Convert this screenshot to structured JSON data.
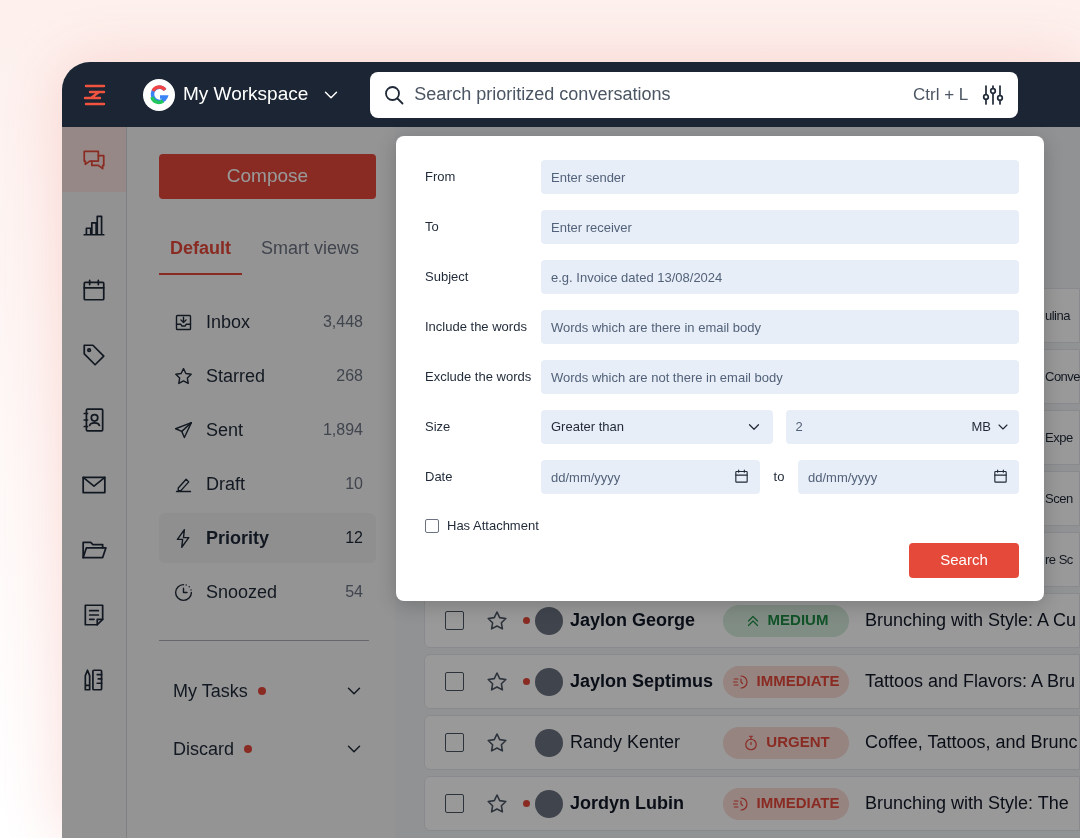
{
  "app_bar": {
    "workspace": "My Workspace",
    "search": {
      "placeholder": "Search prioritized conversations",
      "shortcut": "Ctrl + L"
    }
  },
  "icon_rail": [
    {
      "kind": "chat",
      "selected": true
    },
    {
      "kind": "chart",
      "selected": false
    },
    {
      "kind": "calendar",
      "selected": false
    },
    {
      "kind": "tag",
      "selected": false
    },
    {
      "kind": "contacts",
      "selected": false
    },
    {
      "kind": "mail",
      "selected": false
    },
    {
      "kind": "folder",
      "selected": false
    },
    {
      "kind": "note",
      "selected": false
    },
    {
      "kind": "tools",
      "selected": false
    }
  ],
  "compose": "Compose",
  "tabs": [
    {
      "label": "Default",
      "selected": true
    },
    {
      "label": "Smart views",
      "selected": false
    }
  ],
  "folders": [
    {
      "kind": "inbox",
      "label": "Inbox",
      "count": "3,448",
      "selected": false
    },
    {
      "kind": "star",
      "label": "Starred",
      "count": "268",
      "selected": false
    },
    {
      "kind": "sent",
      "label": "Sent",
      "count": "1,894",
      "selected": false
    },
    {
      "kind": "draft",
      "label": "Draft",
      "count": "10",
      "selected": false
    },
    {
      "kind": "priority",
      "label": "Priority",
      "count": "12",
      "selected": true
    },
    {
      "kind": "snoozed",
      "label": "Snoozed",
      "count": "54",
      "selected": false
    }
  ],
  "sections": [
    {
      "label": "My Tasks",
      "unread": true
    },
    {
      "label": "Discard",
      "unread": true
    }
  ],
  "conversations": [
    {
      "kind": "covered",
      "subject": "ulina"
    },
    {
      "kind": "covered",
      "subject": "Conve"
    },
    {
      "kind": "covered",
      "subject": "Expe"
    },
    {
      "kind": "covered",
      "subject": "Scen"
    },
    {
      "kind": "covered",
      "subject": "re Sc"
    },
    {
      "kind": "full",
      "checked": false,
      "starred": false,
      "unread": true,
      "sender": "Jaylon George",
      "priority": {
        "kind": "medium",
        "label": "MEDIUM"
      },
      "subject": "Brunching with Style: A Cu"
    },
    {
      "kind": "full",
      "checked": false,
      "starred": false,
      "unread": true,
      "sender": "Jaylon Septimus",
      "priority": {
        "kind": "immediate",
        "label": "IMMEDIATE"
      },
      "subject": "Tattoos and Flavors: A Bru"
    },
    {
      "kind": "full",
      "checked": false,
      "starred": false,
      "unread": false,
      "sender": "Randy Kenter",
      "priority": {
        "kind": "urgent",
        "label": "URGENT"
      },
      "subject": "Coffee, Tattoos, and Brunc"
    },
    {
      "kind": "full",
      "checked": false,
      "starred": false,
      "unread": true,
      "sender": "Jordyn Lubin",
      "priority": {
        "kind": "immediate",
        "label": "IMMEDIATE"
      },
      "subject": "Brunching with Style: The"
    }
  ],
  "search_filters": {
    "fields": [
      {
        "label": "From",
        "placeholder": "Enter sender"
      },
      {
        "label": "To",
        "placeholder": "Enter receiver"
      },
      {
        "label": "Subject",
        "placeholder": "e.g. Invoice dated 13/08/2024"
      },
      {
        "label": "Include the words",
        "placeholder": "Words which are there in email body"
      },
      {
        "label": "Exclude the words",
        "placeholder": "Words which are not there in email body"
      }
    ],
    "size": {
      "label": "Size",
      "comparison": "Greater than",
      "value": "2",
      "unit": "MB"
    },
    "date": {
      "label": "Date",
      "from_placeholder": "dd/mm/yyyy",
      "separator": "to",
      "to_placeholder": "dd/mm/yyyy"
    },
    "has_attachment": {
      "label": "Has Attachment",
      "checked": false
    },
    "button": "Search"
  }
}
